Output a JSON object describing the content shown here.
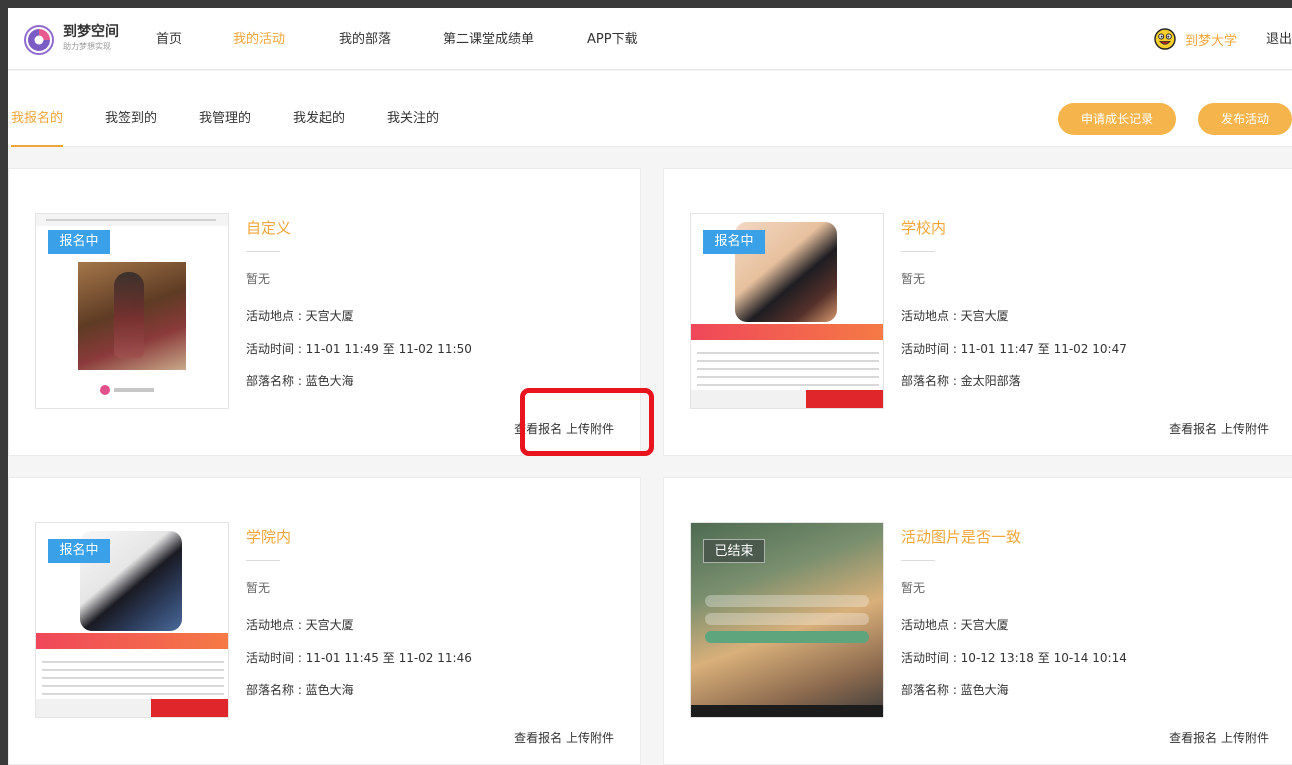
{
  "header": {
    "brand_name": "到梦空间",
    "brand_slogan": "助力梦想实现",
    "nav": [
      "首页",
      "我的活动",
      "我的部落",
      "第二课堂成绩单",
      "APP下载"
    ],
    "active_nav": "我的活动",
    "user_name": "到梦大学",
    "logout": "退出"
  },
  "subtabs": [
    "我报名的",
    "我签到的",
    "我管理的",
    "我发起的",
    "我关注的"
  ],
  "active_subtab": "我报名的",
  "actions": {
    "growth_record": "申请成长记录",
    "publish": "发布活动"
  },
  "cards": [
    {
      "status": "报名中",
      "title": "自定义",
      "desc": "暂无",
      "location": "活动地点 : 天宫大厦",
      "time": "活动时间 : 11-01 11:49 至 11-02 11:50",
      "tribe": "部落名称 : 蓝色大海",
      "view_signups": "查看报名",
      "upload": "上传附件"
    },
    {
      "status": "报名中",
      "title": "学校内",
      "desc": "暂无",
      "location": "活动地点 : 天宫大厦",
      "time": "活动时间 : 11-01 11:47 至 11-02 10:47",
      "tribe": "部落名称 : 金太阳部落",
      "view_signups": "查看报名",
      "upload": "上传附件"
    },
    {
      "status": "报名中",
      "title": "学院内",
      "desc": "暂无",
      "location": "活动地点 : 天宫大厦",
      "time": "活动时间 : 11-01 11:45 至 11-02 11:46",
      "tribe": "部落名称 : 蓝色大海",
      "view_signups": "查看报名",
      "upload": "上传附件"
    },
    {
      "status": "已结束",
      "title": "活动图片是否一致",
      "desc": "暂无",
      "location": "活动地点 : 天宫大厦",
      "time": "活动时间 : 10-12 13:18 至 10-14 10:14",
      "tribe": "部落名称 : 蓝色大海",
      "view_signups": "查看报名",
      "upload": "上传附件"
    }
  ],
  "colors": {
    "accent": "#f0a63a",
    "badge_active": "#3aa0e8",
    "highlight": "#e8141e"
  }
}
